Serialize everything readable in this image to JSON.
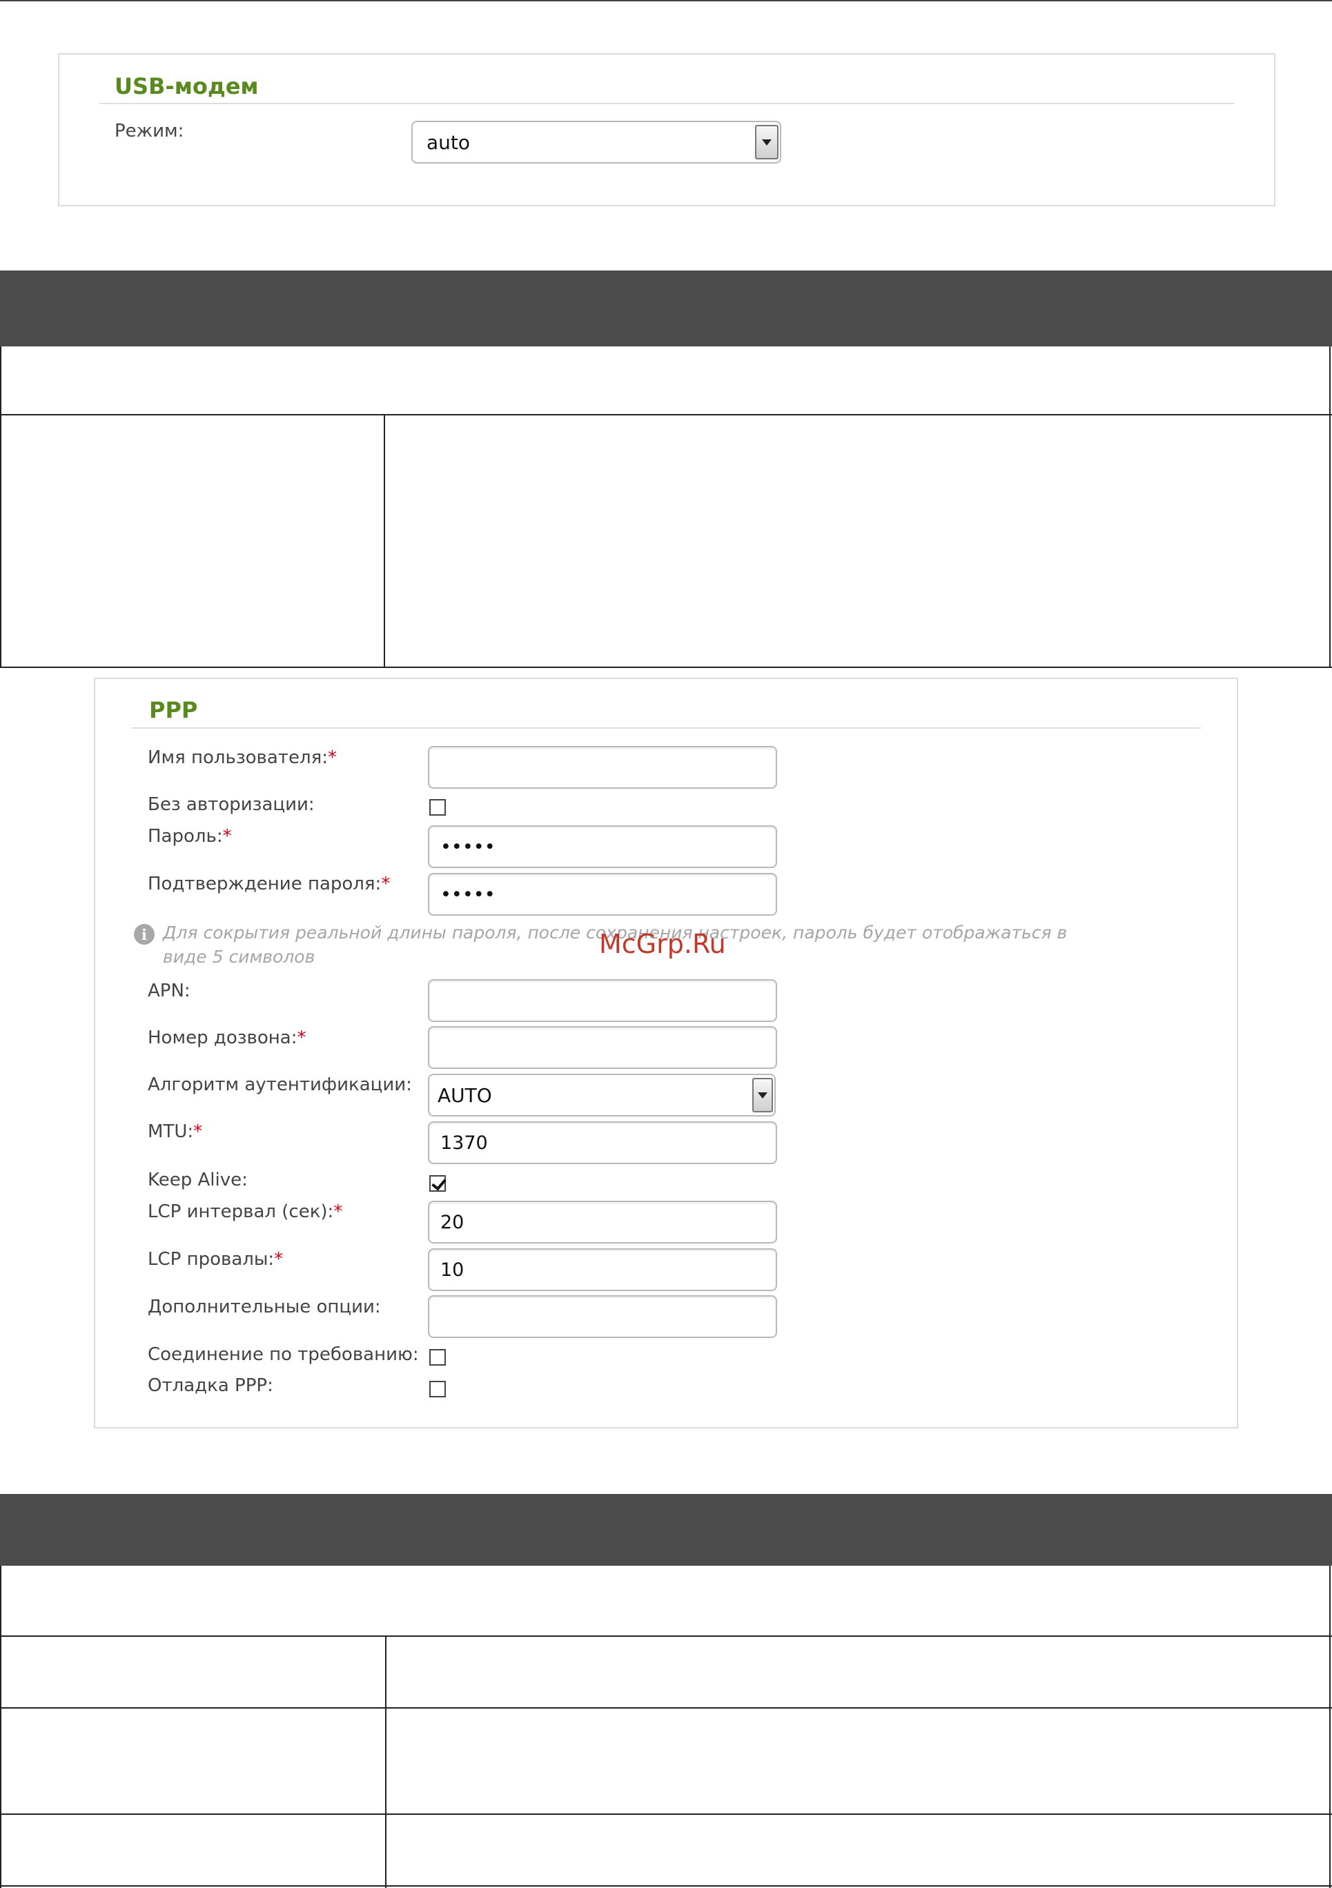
{
  "usb_modem": {
    "title": "USB-модем",
    "mode_label": "Режим:",
    "mode_value": "auto"
  },
  "ppp": {
    "title": "PPP",
    "username": {
      "label": "Имя пользователя:",
      "required": "*",
      "value": ""
    },
    "no_auth": {
      "label": "Без авторизации:",
      "checked": false
    },
    "password": {
      "label": "Пароль:",
      "required": "*",
      "value": "•••••"
    },
    "password_confirm": {
      "label": "Подтверждение пароля:",
      "required": "*",
      "value": "•••••"
    },
    "hint_line1": "Для сокрытия реальной длины пароля, после сохранения настроек, пароль будет отображаться в",
    "hint_line2": "виде 5 символов",
    "apn": {
      "label": "APN:",
      "value": ""
    },
    "dial_number": {
      "label": "Номер дозвона:",
      "required": "*",
      "value": ""
    },
    "auth_algorithm": {
      "label": "Алгоритм аутентификации:",
      "value": "AUTO"
    },
    "mtu": {
      "label": "MTU:",
      "required": "*",
      "value": "1370"
    },
    "keep_alive": {
      "label": "Keep Alive:",
      "checked": true
    },
    "lcp_interval": {
      "label": "LCP интервал (сек):",
      "required": "*",
      "value": "20"
    },
    "lcp_failures": {
      "label": "LCP провалы:",
      "required": "*",
      "value": "10"
    },
    "extra_options": {
      "label": "Дополнительные опции:",
      "value": ""
    },
    "on_demand": {
      "label": "Соединение по требованию:",
      "checked": false
    },
    "ppp_debug": {
      "label": "Отладка PPP:",
      "checked": false
    }
  },
  "watermark": "McGrp.Ru"
}
